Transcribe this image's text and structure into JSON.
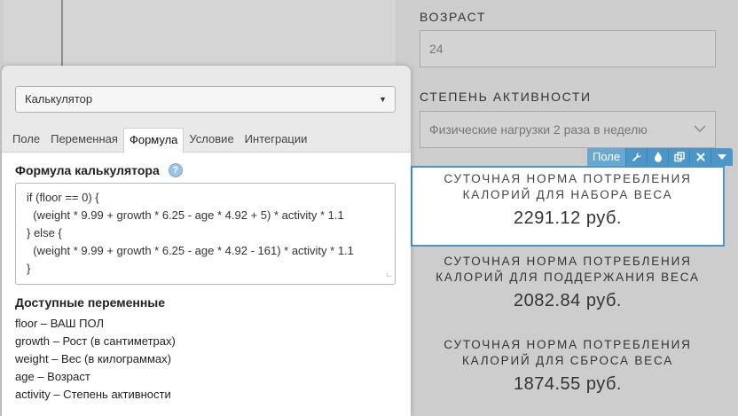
{
  "form": {
    "age_label": "ВОЗРАСТ",
    "age_value": "24",
    "activity_label": "СТЕПЕНЬ АКТИВНОСТИ",
    "activity_value": "Физические нагрузки 2 раза в неделю"
  },
  "toolbar": {
    "label": "Поле",
    "icons": [
      "wrench-icon",
      "drop-icon",
      "copy-icon",
      "close-icon",
      "caret-down-icon"
    ]
  },
  "results": [
    {
      "title": "СУТОЧНАЯ НОРМА ПОТРЕБЛЕНИЯ КАЛОРИЙ ДЛЯ НАБОРА ВЕСА",
      "value": "2291.12 руб."
    },
    {
      "title": "СУТОЧНАЯ НОРМА ПОТРЕБЛЕНИЯ КАЛОРИЙ ДЛЯ ПОДДЕРЖАНИЯ ВЕСА",
      "value": "2082.84 руб."
    },
    {
      "title": "СУТОЧНАЯ НОРМА ПОТРЕБЛЕНИЯ КАЛОРИЙ ДЛЯ СБРОСА ВЕСА",
      "value": "1874.55 руб."
    }
  ],
  "panel": {
    "type_select": "Калькулятор",
    "tabs": [
      "Поле",
      "Переменная",
      "Формула",
      "Условие",
      "Интеграции"
    ],
    "active_tab": "Формула",
    "formula_title": "Формула калькулятора",
    "formula": "if (floor == 0) {\n  (weight * 9.99 + growth * 6.25 - age * 4.92 + 5) * activity * 1.1\n} else {\n  (weight * 9.99 + growth * 6.25 - age * 4.92 - 161) * activity * 1.1\n}",
    "vars_title": "Доступные переменные",
    "variables": [
      "floor – ВАШ ПОЛ",
      "growth – Рост (в сантиметрах)",
      "weight – Вес (в килограммах)",
      "age – Возраст",
      "activity – Степень активности"
    ]
  },
  "colors": {
    "accent": "#4c97c8",
    "background": "#cdcdcd"
  }
}
